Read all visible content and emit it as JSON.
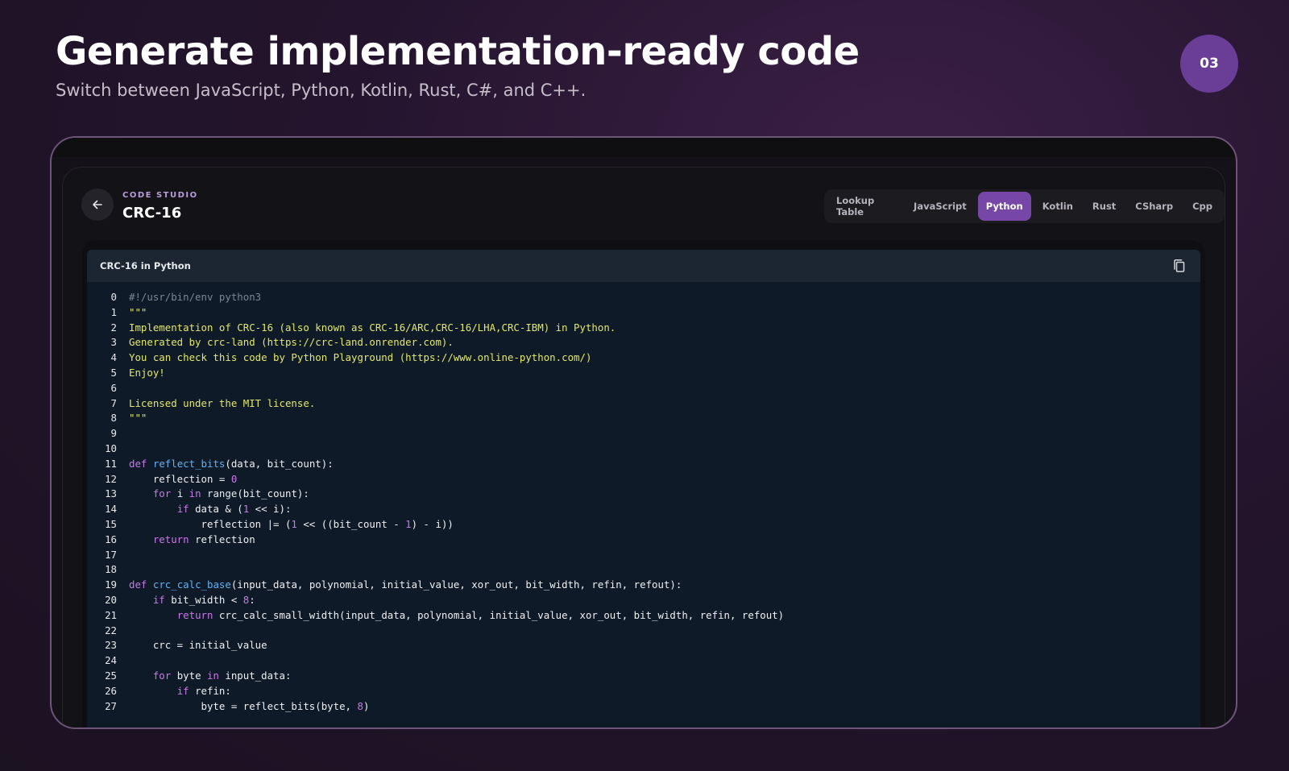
{
  "header": {
    "title": "Generate implementation-ready code",
    "subtitle": "Switch between JavaScript, Python, Kotlin, Rust, C#, and C++.",
    "step": "03"
  },
  "studio": {
    "kicker": "CODE STUDIO",
    "title": "CRC-16",
    "tabs": [
      {
        "label": "Lookup Table",
        "active": false
      },
      {
        "label": "JavaScript",
        "active": false
      },
      {
        "label": "Python",
        "active": true
      },
      {
        "label": "Kotlin",
        "active": false
      },
      {
        "label": "Rust",
        "active": false
      },
      {
        "label": "CSharp",
        "active": false
      },
      {
        "label": "Cpp",
        "active": false
      }
    ]
  },
  "code": {
    "title": "CRC-16 in Python",
    "language": "python",
    "lines": [
      [
        [
          "cm",
          "#!/usr/bin/env python3"
        ]
      ],
      [
        [
          "str",
          "\"\"\""
        ]
      ],
      [
        [
          "str",
          "Implementation of CRC-16 (also known as CRC-16/ARC,CRC-16/LHA,CRC-IBM) in Python."
        ]
      ],
      [
        [
          "str",
          "Generated by crc-land (https://crc-land.onrender.com)."
        ]
      ],
      [
        [
          "str",
          "You can check this code by Python Playground (https://www.online-python.com/)"
        ]
      ],
      [
        [
          "str",
          "Enjoy!"
        ]
      ],
      [],
      [
        [
          "str",
          "Licensed under the MIT license."
        ]
      ],
      [
        [
          "str",
          "\"\"\""
        ]
      ],
      [],
      [],
      [
        [
          "kw",
          "def"
        ],
        [
          "",
          " "
        ],
        [
          "fn",
          "reflect_bits"
        ],
        [
          "",
          "(data, bit_count):"
        ]
      ],
      [
        [
          "",
          "    reflection = "
        ],
        [
          "num",
          "0"
        ]
      ],
      [
        [
          "",
          "    "
        ],
        [
          "kw",
          "for"
        ],
        [
          "",
          " i "
        ],
        [
          "kw",
          "in"
        ],
        [
          "",
          " "
        ],
        [
          "bi",
          "range"
        ],
        [
          "",
          "(bit_count):"
        ]
      ],
      [
        [
          "",
          "        "
        ],
        [
          "kw",
          "if"
        ],
        [
          "",
          " data & ("
        ],
        [
          "num",
          "1"
        ],
        [
          "",
          " << i):"
        ]
      ],
      [
        [
          "",
          "            reflection |= ("
        ],
        [
          "num",
          "1"
        ],
        [
          "",
          " << ((bit_count - "
        ],
        [
          "num",
          "1"
        ],
        [
          "",
          ") - i))"
        ]
      ],
      [
        [
          "",
          "    "
        ],
        [
          "kw",
          "return"
        ],
        [
          "",
          " reflection"
        ]
      ],
      [],
      [],
      [
        [
          "kw",
          "def"
        ],
        [
          "",
          " "
        ],
        [
          "fn",
          "crc_calc_base"
        ],
        [
          "",
          "(input_data, polynomial, initial_value, xor_out, bit_width, refin, refout):"
        ]
      ],
      [
        [
          "",
          "    "
        ],
        [
          "kw",
          "if"
        ],
        [
          "",
          " bit_width < "
        ],
        [
          "num",
          "8"
        ],
        [
          "",
          ":"
        ]
      ],
      [
        [
          "",
          "        "
        ],
        [
          "kw",
          "return"
        ],
        [
          "",
          " crc_calc_small_width(input_data, polynomial, initial_value, xor_out, bit_width, refin, refout)"
        ]
      ],
      [],
      [
        [
          "",
          "    crc = initial_value"
        ]
      ],
      [],
      [
        [
          "",
          "    "
        ],
        [
          "kw",
          "for"
        ],
        [
          "",
          " byte "
        ],
        [
          "kw",
          "in"
        ],
        [
          "",
          " input_data:"
        ]
      ],
      [
        [
          "",
          "        "
        ],
        [
          "kw",
          "if"
        ],
        [
          "",
          " refin:"
        ]
      ],
      [
        [
          "",
          "            byte = reflect_bits(byte, "
        ],
        [
          "num",
          "8"
        ],
        [
          "",
          ")"
        ]
      ]
    ]
  }
}
